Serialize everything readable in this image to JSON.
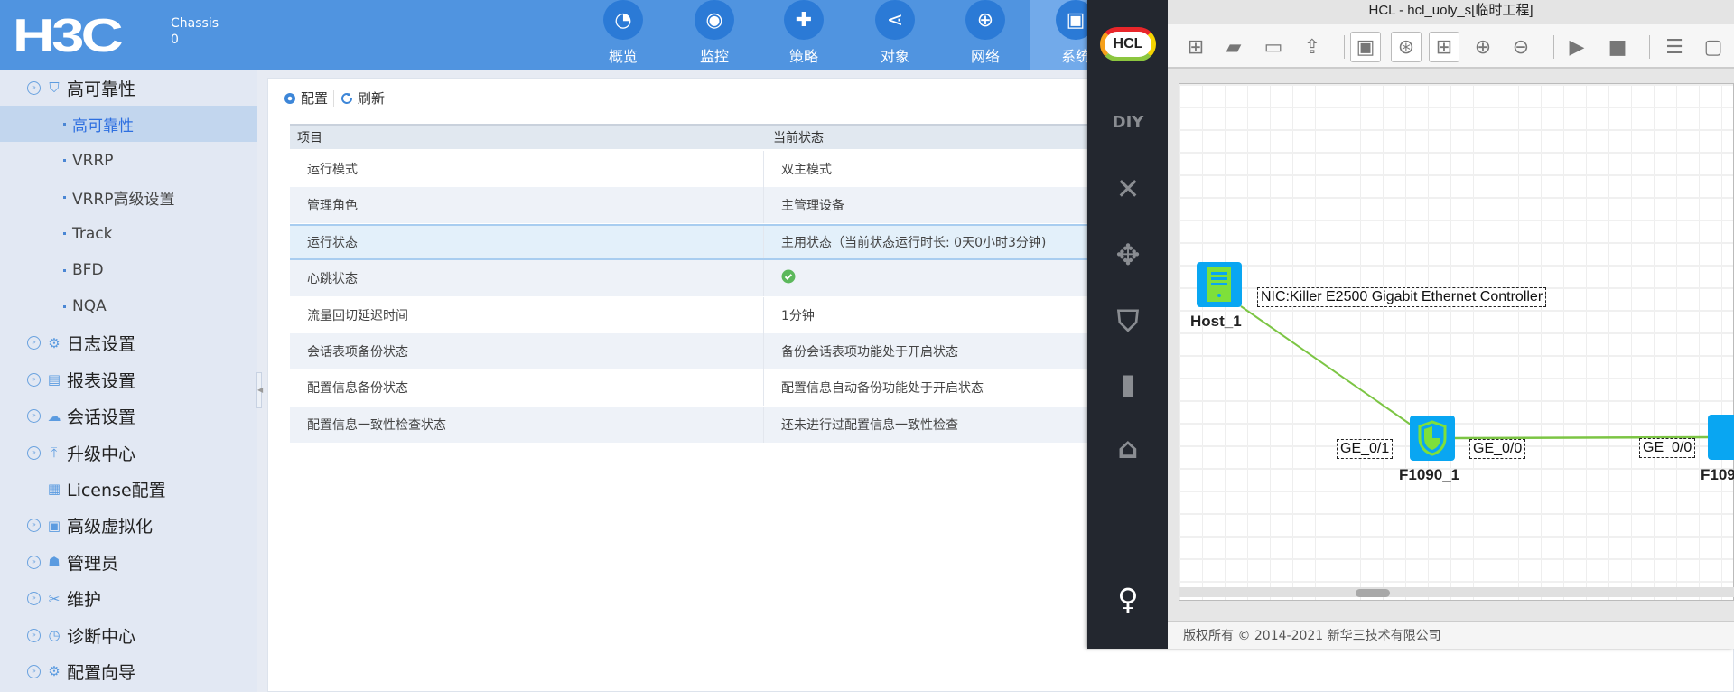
{
  "header": {
    "logo": "H3C",
    "chassis_label": "Chassis",
    "chassis_value": "0",
    "nav": [
      {
        "label": "概览",
        "icon": "dashboard-icon"
      },
      {
        "label": "监控",
        "icon": "monitor-camera-icon"
      },
      {
        "label": "策略",
        "icon": "shield-plus-icon"
      },
      {
        "label": "对象",
        "icon": "share-nodes-icon"
      },
      {
        "label": "网络",
        "icon": "globe-icon"
      },
      {
        "label": "系统",
        "icon": "system-monitor-icon",
        "active": true
      }
    ]
  },
  "sidebar": {
    "items": [
      {
        "label": "高可靠性",
        "type": "group",
        "icon": "shield-icon"
      },
      {
        "label": "高可靠性",
        "type": "sub",
        "active": true
      },
      {
        "label": "VRRP",
        "type": "sub"
      },
      {
        "label": "VRRP高级设置",
        "type": "sub"
      },
      {
        "label": "Track",
        "type": "sub"
      },
      {
        "label": "BFD",
        "type": "sub"
      },
      {
        "label": "NQA",
        "type": "sub"
      },
      {
        "label": "日志设置",
        "type": "group",
        "icon": "log-settings-icon"
      },
      {
        "label": "报表设置",
        "type": "group",
        "icon": "report-icon"
      },
      {
        "label": "会话设置",
        "type": "group",
        "icon": "session-icon"
      },
      {
        "label": "升级中心",
        "type": "group",
        "icon": "upload-icon"
      },
      {
        "label": "License配置",
        "type": "leaf",
        "icon": "license-icon"
      },
      {
        "label": "高级虚拟化",
        "type": "group",
        "icon": "virtualization-icon"
      },
      {
        "label": "管理员",
        "type": "group",
        "icon": "admin-icon"
      },
      {
        "label": "维护",
        "type": "group",
        "icon": "tools-icon"
      },
      {
        "label": "诊断中心",
        "type": "group",
        "icon": "diagnosis-icon"
      },
      {
        "label": "配置向导",
        "type": "group",
        "icon": "wizard-icon"
      }
    ]
  },
  "toolbar": {
    "config": "配置",
    "refresh": "刷新"
  },
  "table": {
    "headers": [
      "项目",
      "当前状态"
    ],
    "rows": [
      [
        "运行模式",
        "双主模式"
      ],
      [
        "管理角色",
        "主管理设备"
      ],
      [
        "运行状态",
        "主用状态（当前状态运行时长: 0天0小时3分钟)"
      ],
      [
        "心跳状态",
        ""
      ],
      [
        "流量回切延迟时间",
        "1分钟"
      ],
      [
        "会话表项备份状态",
        "备份会话表项功能处于开启状态"
      ],
      [
        "配置信息备份状态",
        "配置信息自动备份功能处于开启状态"
      ],
      [
        "配置信息一致性检查状态",
        "还未进行过配置信息一致性检查"
      ]
    ],
    "selected_row": 2,
    "heartbeat_status_icon": "check-circle-icon"
  },
  "hcl": {
    "logo": "HCL",
    "title": "HCL - hcl_uoly_s[临时工程]",
    "toolbar": [
      "new-project-icon",
      "open-folder-icon",
      "save-icon",
      "export-icon",
      "show-interface-icon",
      "topology-icon",
      "grid-icon",
      "zoom-in-icon",
      "zoom-out-icon",
      "start-icon",
      "stop-icon",
      "add-list-icon",
      "add-window-icon"
    ],
    "left_icons": [
      "diy-icon",
      "switch-icon",
      "router-icon",
      "firewall-icon",
      "host-icon",
      "terminal-icon",
      "user-icon"
    ],
    "topology": {
      "host": "Host_1",
      "nic": "NIC:Killer E2500 Gigabit Ethernet Controller",
      "fw1": "F1090_1",
      "fw2": "F109",
      "p1": "GE_0/1",
      "p2": "GE_0/0",
      "p3": "GE_0/0"
    },
    "link_color": "#7cc544",
    "footer": "版权所有 © 2014-2021 新华三技术有限公司"
  }
}
